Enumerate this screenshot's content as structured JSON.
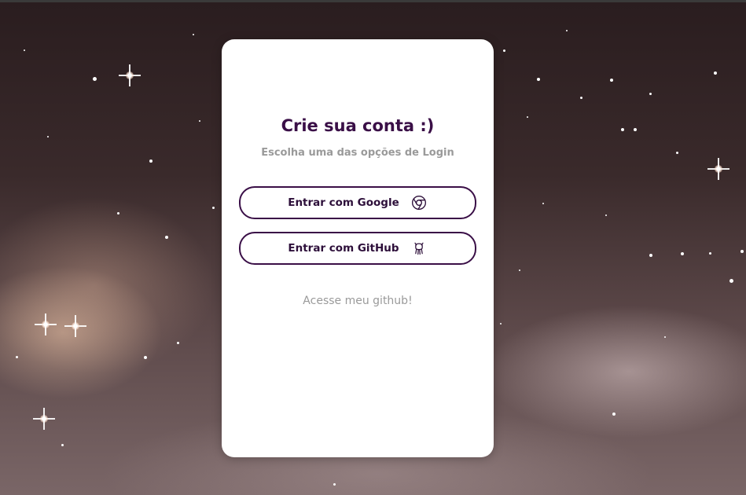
{
  "card": {
    "title": "Crie sua conta :)",
    "subtitle": "Escolha uma das opções de Login"
  },
  "buttons": {
    "google": {
      "label": "Entrar com Google",
      "icon": "chrome-icon"
    },
    "github": {
      "label": "Entrar com GitHub",
      "icon": "github-icon"
    }
  },
  "footer_link": {
    "label": "Acesse meu github!"
  },
  "colors": {
    "accent": "#3a0f47",
    "muted_text": "#9a9a9a",
    "card_bg": "#ffffff"
  }
}
